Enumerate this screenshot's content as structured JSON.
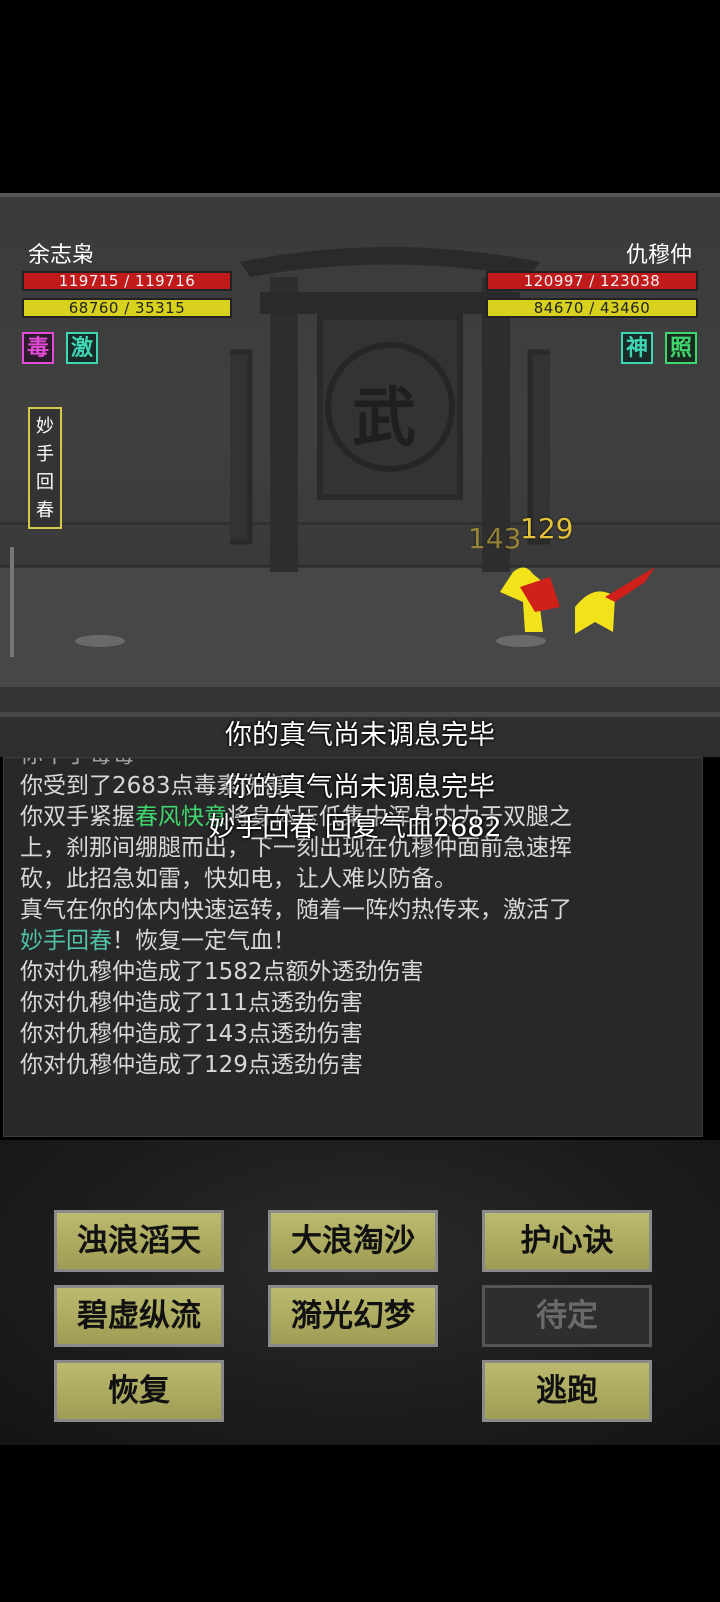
{
  "player": {
    "name": "余志枭",
    "hp": "119715 / 119716",
    "qi": "68760 / 35315",
    "buffs": [
      {
        "char": "毒",
        "color": "#e14ad4"
      },
      {
        "char": "激",
        "color": "#3fd6b5"
      }
    ],
    "active_skill": [
      "妙",
      "手",
      "回",
      "春"
    ]
  },
  "enemy": {
    "name": "仇穆仲",
    "hp": "120997 / 123038",
    "qi": "84670 / 43460",
    "buffs": [
      {
        "char": "神",
        "color": "#3fd6b5"
      },
      {
        "char": "照",
        "color": "#3fd66e"
      }
    ]
  },
  "gate_sign": "武",
  "damage_numbers": {
    "back": "143",
    "front": "129"
  },
  "float_messages": [
    "你的真气尚未调息完毕",
    "你的真气尚未调息完毕",
    "妙手回春 回复气血2682"
  ],
  "log": {
    "partial_top": "你中了毒毒",
    "line1": "你受到了2683点毒素伤害",
    "line2_pre": "你双手紧握",
    "line2_skill": "春风快意",
    "line2_post": "将身体压低集中浑身内力于双腿之",
    "line3": "上，刹那间绷腿而出，下一刻出现在仇穆仲面前急速挥",
    "line4": "砍，此招急如雷，快如电，让人难以防备。",
    "line5": "真气在你的体内快速运转，随着一阵灼热传来，激活了",
    "line6_skill": "妙手回春",
    "line6_post": "！恢复一定气血！",
    "line7": "你对仇穆仲造成了1582点额外透劲伤害",
    "line8": "你对仇穆仲造成了111点透劲伤害",
    "line9": "你对仇穆仲造成了143点透劲伤害",
    "line10": "你对仇穆仲造成了129点透劲伤害"
  },
  "buttons": {
    "b1": "浊浪滔天",
    "b2": "大浪淘沙",
    "b3": "护心诀",
    "b4": "碧虚纵流",
    "b5": "漪光幻梦",
    "b6": "待定",
    "b7": "恢复",
    "b8": "逃跑"
  }
}
